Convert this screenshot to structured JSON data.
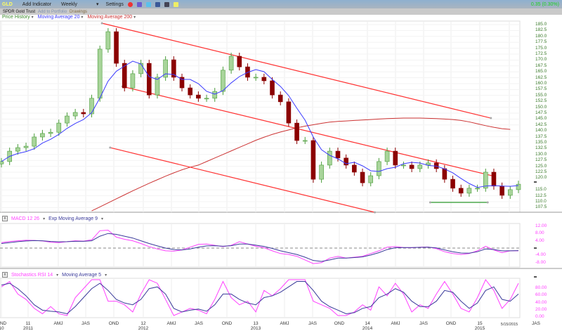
{
  "toolbar": {
    "symbol": "GLD",
    "add_indicator": "Add Indicator",
    "period": "Weekly",
    "settings": "Settings",
    "icons": [
      "alarm-icon",
      "document-icon",
      "twitter-icon",
      "facebook-icon",
      "home-icon",
      "chat-icon"
    ],
    "change": "0.35 (0.30%)",
    "change_color": "#1fd01f"
  },
  "subbar": {
    "name": "SPDR Gold Trust",
    "add_portfolio": "Add to Portfolio",
    "drawings": "Drawings"
  },
  "legend": {
    "price": "Price History",
    "ma20": "Moving Average 20",
    "ma200": "Moving Average 200"
  },
  "colors": {
    "up": "#4a9c3a",
    "down": "#8b0000",
    "ma20": "#3b3bff",
    "ma200": "#cc3333",
    "trend": "#ff3030",
    "support": "#2d9a2d",
    "macd": "#ff40ff",
    "signal": "#3a3a9a"
  },
  "chart_data": [
    {
      "type": "candlestick",
      "title": "",
      "x_start": "2010-10-18",
      "step_weeks": 4,
      "closes": [
        127.0,
        131.4,
        132.9,
        133.5,
        137.4,
        138.9,
        139.4,
        143.3,
        146.3,
        147.8,
        147.2,
        153.8,
        174.6,
        182.0,
        168.6,
        158.2,
        164.2,
        168.6,
        155.2,
        162.7,
        170.1,
        162.7,
        158.2,
        155.2,
        153.8,
        153.8,
        156.7,
        165.7,
        171.6,
        167.1,
        162.7,
        162.7,
        161.2,
        155.2,
        152.3,
        143.3,
        135.9,
        135.9,
        119.5,
        125.5,
        131.4,
        128.5,
        125.5,
        122.5,
        118.0,
        121.0,
        127.0,
        131.4,
        125.5,
        125.5,
        124.0,
        125.5,
        126.4,
        124.0,
        119.5,
        115.7,
        113.6,
        115.7,
        115.7,
        122.5,
        116.6,
        112.7,
        115.1,
        117.4
      ],
      "ma200": [
        null,
        null,
        null,
        null,
        null,
        null,
        null,
        null,
        null,
        null,
        null,
        106.1,
        107.8,
        109.5,
        111.2,
        112.9,
        114.6,
        116.2,
        117.8,
        119.3,
        120.8,
        122.2,
        123.5,
        124.6,
        125.5,
        127.0,
        128.5,
        130.0,
        131.5,
        133.0,
        134.5,
        136.0,
        137.3,
        138.5,
        139.5,
        140.4,
        141.3,
        142.0,
        142.6,
        143.2,
        143.7,
        144.0,
        144.2,
        144.4,
        144.6,
        144.8,
        145.0,
        145.2,
        145.3,
        145.4,
        145.4,
        145.4,
        145.3,
        145.2,
        145.0,
        144.8,
        144.4,
        143.8,
        143.0,
        142.2,
        141.5,
        140.9,
        140.6
      ],
      "y_ticks": [
        185.0,
        182.5,
        180.0,
        177.5,
        175.0,
        172.5,
        170.0,
        167.5,
        165.0,
        162.5,
        160.0,
        157.5,
        155.0,
        152.5,
        150.0,
        147.5,
        145.0,
        142.5,
        140.0,
        137.5,
        135.0,
        132.5,
        130.0,
        127.5,
        125.0,
        122.5,
        120.0,
        115.0,
        112.5,
        110.0,
        107.5
      ],
      "last_price": "117.5",
      "ylim": [
        107.5,
        185.0
      ],
      "trendlines": [
        {
          "from": [
            "2011-09-26",
            185.6
          ],
          "to": [
            "2015-05-15",
            145.4
          ]
        },
        {
          "from": [
            "2011-12-05",
            158.8
          ],
          "to": [
            "2015-05-29",
            120.7
          ]
        },
        {
          "from": [
            "2011-10-24",
            132.9
          ],
          "to": [
            "2014-04-14",
            105.5
          ]
        },
        {
          "from": [
            "2014-10-20",
            109.7
          ],
          "to": [
            "2015-05-04",
            109.7
          ],
          "color": "support"
        }
      ]
    },
    {
      "type": "line",
      "title": "MACD 12 26",
      "signal_name": "Exp Moving Average 9",
      "ylim": [
        -9,
        13
      ],
      "macd": [
        3.0,
        3.6,
        4.0,
        4.3,
        4.2,
        3.9,
        3.2,
        3.0,
        3.5,
        4.0,
        3.8,
        4.5,
        9.5,
        9.8,
        6.0,
        4.8,
        4.0,
        2.5,
        0.8,
        -0.5,
        -1.5,
        -1.7,
        -1.0,
        0.5,
        2.0,
        2.2,
        1.5,
        0.8,
        1.5,
        3.5,
        2.2,
        1.0,
        0.2,
        -1.5,
        -3.0,
        -3.5,
        -4.5,
        -6.5,
        -8.5,
        -8.0,
        -5.5,
        -4.5,
        -5.5,
        -5.0,
        -4.5,
        -3.0,
        -1.5,
        0.5,
        0.8,
        0.3,
        0.2,
        0.5,
        0.6,
        -0.3,
        -2.0,
        -3.0,
        -3.5,
        -3.0,
        -1.5,
        1.0,
        -1.0,
        -2.5,
        -1.5,
        -1.5
      ],
      "signal": [
        2.5,
        3.0,
        3.5,
        3.9,
        4.1,
        4.0,
        3.6,
        3.4,
        3.5,
        3.7,
        3.7,
        4.0,
        6.5,
        8.0,
        7.5,
        6.5,
        5.5,
        4.0,
        2.5,
        1.2,
        0.0,
        -0.8,
        -1.0,
        -0.5,
        0.5,
        1.2,
        1.3,
        1.0,
        1.3,
        2.2,
        2.2,
        1.6,
        0.9,
        -0.2,
        -1.5,
        -2.5,
        -3.5,
        -5.0,
        -6.8,
        -7.3,
        -6.5,
        -5.5,
        -5.5,
        -5.2,
        -4.8,
        -3.8,
        -2.5,
        -0.8,
        0.2,
        0.3,
        0.3,
        0.4,
        0.5,
        0.1,
        -1.0,
        -2.0,
        -2.7,
        -2.8,
        -2.0,
        -0.5,
        -0.8,
        -1.5,
        -1.5,
        -1.4
      ],
      "y_ticks": [
        12.0,
        8.0,
        4.0,
        -4.0,
        -8.0
      ],
      "last_value": "-0.98"
    },
    {
      "type": "line",
      "title": "Stochastics RSI 14",
      "ma_name": "Moving Average 5",
      "ylim": [
        0,
        100
      ],
      "stoch": [
        80,
        95,
        60,
        45,
        20,
        5,
        25,
        5,
        0,
        50,
        75,
        100,
        100,
        40,
        40,
        30,
        10,
        60,
        100,
        90,
        45,
        0,
        10,
        20,
        15,
        5,
        45,
        95,
        50,
        30,
        40,
        10,
        70,
        55,
        75,
        100,
        100,
        100,
        40,
        30,
        20,
        0,
        0,
        10,
        30,
        15,
        80,
        55,
        90,
        60,
        10,
        30,
        20,
        60,
        95,
        60,
        20,
        10,
        50,
        100,
        70,
        20,
        45,
        90
      ],
      "ma": [
        85,
        90,
        75,
        55,
        30,
        15,
        12,
        10,
        5,
        25,
        50,
        75,
        90,
        70,
        45,
        35,
        30,
        45,
        75,
        80,
        60,
        20,
        10,
        15,
        18,
        12,
        30,
        60,
        60,
        45,
        35,
        30,
        50,
        55,
        65,
        80,
        95,
        95,
        70,
        40,
        25,
        15,
        5,
        8,
        20,
        25,
        50,
        60,
        75,
        65,
        40,
        25,
        25,
        40,
        70,
        65,
        40,
        20,
        35,
        70,
        80,
        45,
        40,
        60
      ],
      "y_ticks": [
        80.0,
        60.0,
        40.0,
        20.0,
        0.0
      ],
      "last_value": "100.00"
    }
  ],
  "x_axis": {
    "labels": [
      {
        "t": "OND",
        "y": "10"
      },
      {
        "t": "11",
        "y": "2011"
      },
      {
        "t": "AMJ"
      },
      {
        "t": "JAS"
      },
      {
        "t": "OND"
      },
      {
        "t": "12",
        "y": "2012"
      },
      {
        "t": "AMJ"
      },
      {
        "t": "JAS"
      },
      {
        "t": "OND"
      },
      {
        "t": "13",
        "y": "2013"
      },
      {
        "t": "AMJ"
      },
      {
        "t": "JAS"
      },
      {
        "t": "OND"
      },
      {
        "t": "14",
        "y": "2014"
      },
      {
        "t": "AMJ"
      },
      {
        "t": "JAS"
      },
      {
        "t": "OND"
      },
      {
        "t": "15",
        "y": "2015"
      },
      {
        "t": "5/15/2015"
      },
      {
        "t": "JAS"
      }
    ]
  }
}
